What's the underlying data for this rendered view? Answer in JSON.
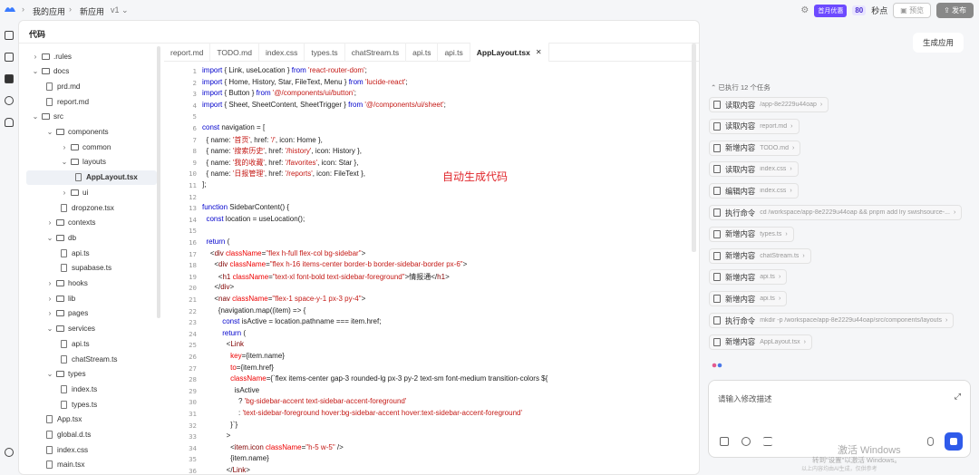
{
  "topbar": {
    "breadcrumb": [
      "我的应用",
      "新应用",
      "v1"
    ],
    "promo": "首月优惠",
    "countdown_value": "80",
    "countdown_unit": "秒点",
    "preview": "预览",
    "publish": "发布"
  },
  "code_panel": {
    "title": "代码",
    "tree": [
      {
        "label": ".rules",
        "type": "folder",
        "depth": 0,
        "open": false
      },
      {
        "label": "docs",
        "type": "folder",
        "depth": 0,
        "open": true
      },
      {
        "label": "prd.md",
        "type": "file",
        "depth": 1
      },
      {
        "label": "report.md",
        "type": "file",
        "depth": 1
      },
      {
        "label": "src",
        "type": "folder",
        "depth": 0,
        "open": true
      },
      {
        "label": "components",
        "type": "folder",
        "depth": 1,
        "open": true
      },
      {
        "label": "common",
        "type": "folder",
        "depth": 2,
        "open": false
      },
      {
        "label": "layouts",
        "type": "folder",
        "depth": 2,
        "open": true
      },
      {
        "label": "AppLayout.tsx",
        "type": "file",
        "depth": 3,
        "selected": true
      },
      {
        "label": "ui",
        "type": "folder",
        "depth": 2,
        "open": false
      },
      {
        "label": "dropzone.tsx",
        "type": "file",
        "depth": 2
      },
      {
        "label": "contexts",
        "type": "folder",
        "depth": 1,
        "open": false
      },
      {
        "label": "db",
        "type": "folder",
        "depth": 1,
        "open": true
      },
      {
        "label": "api.ts",
        "type": "file",
        "depth": 2
      },
      {
        "label": "supabase.ts",
        "type": "file",
        "depth": 2
      },
      {
        "label": "hooks",
        "type": "folder",
        "depth": 1,
        "open": false
      },
      {
        "label": "lib",
        "type": "folder",
        "depth": 1,
        "open": false
      },
      {
        "label": "pages",
        "type": "folder",
        "depth": 1,
        "open": false
      },
      {
        "label": "services",
        "type": "folder",
        "depth": 1,
        "open": true
      },
      {
        "label": "api.ts",
        "type": "file",
        "depth": 2
      },
      {
        "label": "chatStream.ts",
        "type": "file",
        "depth": 2
      },
      {
        "label": "types",
        "type": "folder",
        "depth": 1,
        "open": true
      },
      {
        "label": "index.ts",
        "type": "file",
        "depth": 2
      },
      {
        "label": "types.ts",
        "type": "file",
        "depth": 2
      },
      {
        "label": "App.tsx",
        "type": "file",
        "depth": 1
      },
      {
        "label": "global.d.ts",
        "type": "file",
        "depth": 1
      },
      {
        "label": "index.css",
        "type": "file",
        "depth": 1
      },
      {
        "label": "main.tsx",
        "type": "file",
        "depth": 1
      }
    ],
    "tabs": [
      "report.md",
      "TODO.md",
      "index.css",
      "types.ts",
      "chatStream.ts",
      "api.ts",
      "api.ts",
      "AppLayout.tsx"
    ],
    "active_tab": "AppLayout.tsx",
    "annotation": "自动生成代码",
    "code_lines": [
      "import { Link, useLocation } from 'react-router-dom';",
      "import { Home, History, Star, FileText, Menu } from 'lucide-react';",
      "import { Button } from '@/components/ui/button';",
      "import { Sheet, SheetContent, SheetTrigger } from '@/components/ui/sheet';",
      "",
      "const navigation = [",
      "  { name: '首页', href: '/', icon: Home },",
      "  { name: '搜索历史', href: '/history', icon: History },",
      "  { name: '我的收藏', href: '/favorites', icon: Star },",
      "  { name: '日报管理', href: '/reports', icon: FileText },",
      "];",
      "",
      "function SidebarContent() {",
      "  const location = useLocation();",
      "",
      "  return (",
      "    <div className=\"flex h-full flex-col bg-sidebar\">",
      "      <div className=\"flex h-16 items-center border-b border-sidebar-border px-6\">",
      "        <h1 className=\"text-xl font-bold text-sidebar-foreground\">情报通</h1>",
      "      </div>",
      "      <nav className=\"flex-1 space-y-1 px-3 py-4\">",
      "        {navigation.map((item) => {",
      "          const isActive = location.pathname === item.href;",
      "          return (",
      "            <Link",
      "              key={item.name}",
      "              to={item.href}",
      "              className={`flex items-center gap-3 rounded-lg px-3 py-2 text-sm font-medium transition-colors ${",
      "                isActive",
      "                  ? 'bg-sidebar-accent text-sidebar-accent-foreground'",
      "                  : 'text-sidebar-foreground hover:bg-sidebar-accent hover:text-sidebar-accent-foreground'",
      "              }`}",
      "            >",
      "              <item.icon className=\"h-5 w-5\" />",
      "              {item.name}",
      "            </Link>"
    ]
  },
  "right_panel": {
    "generate_button": "生成应用",
    "tasks_header": "已执行 12 个任务",
    "tasks": [
      {
        "action": "读取内容",
        "path": "/app-8e2229u44oap",
        "icon": "file-icon"
      },
      {
        "action": "读取内容",
        "path": "report.md",
        "icon": "file-icon"
      },
      {
        "action": "新增内容",
        "path": "TODO.md",
        "icon": "file-icon"
      },
      {
        "action": "读取内容",
        "path": "index.css",
        "icon": "file-icon"
      },
      {
        "action": "编辑内容",
        "path": "index.css",
        "icon": "edit-icon"
      },
      {
        "action": "执行命令",
        "path": "cd /workspace/app-8e2229u44oap && pnpm add lry swishsource-...",
        "icon": "terminal-icon"
      },
      {
        "action": "新增内容",
        "path": "types.ts",
        "icon": "file-icon"
      },
      {
        "action": "新增内容",
        "path": "chatStream.ts",
        "icon": "file-icon"
      },
      {
        "action": "新增内容",
        "path": "api.ts",
        "icon": "file-icon"
      },
      {
        "action": "新增内容",
        "path": "api.ts",
        "icon": "file-icon"
      },
      {
        "action": "执行命令",
        "path": "mkdir -p /workspace/app-8e2229u44oap/src/components/layouts",
        "icon": "terminal-icon"
      },
      {
        "action": "新增内容",
        "path": "AppLayout.tsx",
        "icon": "file-icon"
      }
    ],
    "input_placeholder": "请输入修改描述"
  },
  "watermark": {
    "line1": "激活 Windows",
    "line2": "转到\"设置\"以激活 Windows。",
    "line3": "以上内容均由AI生成，仅供参考"
  },
  "colors": {
    "accent": "#2f5bea",
    "promo": "#6d4aff",
    "annotation": "#e0262b"
  }
}
